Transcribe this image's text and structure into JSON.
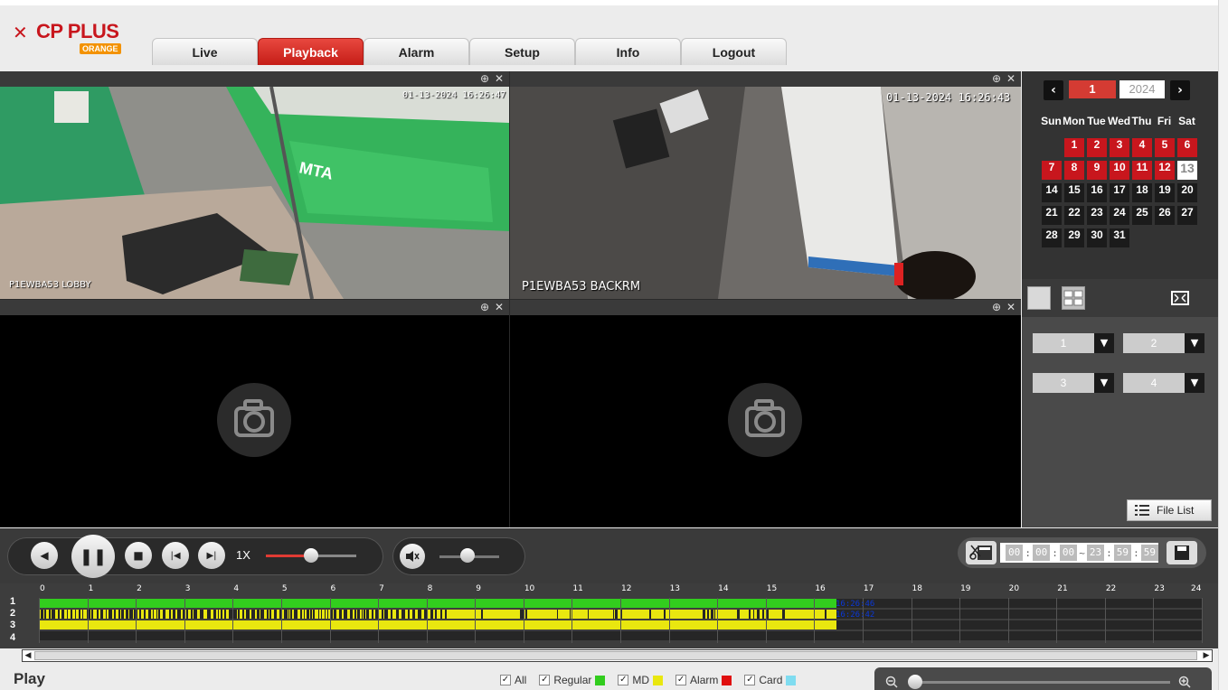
{
  "header": {
    "logo_text": "CP PLUS",
    "logo_sub": "ORANGE",
    "tabs": [
      "Live",
      "Playback",
      "Alarm",
      "Setup",
      "Info",
      "Logout"
    ],
    "active_tab": "Playback"
  },
  "panes": [
    {
      "label": "P1EWBA53 LOBBY",
      "timestamp": "01-13-2024 16:26:47"
    },
    {
      "label": "P1EWBA53 BACKRM",
      "timestamp": "01-13-2024 16:26:43"
    },
    {
      "label": "",
      "timestamp": ""
    },
    {
      "label": "",
      "timestamp": ""
    }
  ],
  "calendar": {
    "month": "1",
    "year": "2024",
    "prev": "‹",
    "next": "›",
    "dow": [
      "Sun",
      "Mon",
      "Tue",
      "Wed",
      "Thu",
      "Fri",
      "Sat"
    ],
    "days": [
      "1",
      "2",
      "3",
      "4",
      "5",
      "6",
      "7",
      "8",
      "9",
      "10",
      "11",
      "12",
      "13",
      "14",
      "15",
      "16",
      "17",
      "18",
      "19",
      "20",
      "21",
      "22",
      "23",
      "24",
      "25",
      "26",
      "27",
      "28",
      "29",
      "30",
      "31"
    ],
    "today": "13"
  },
  "channels": [
    "1",
    "2",
    "3",
    "4"
  ],
  "file_list_label": "File List",
  "controls": {
    "speed": "1X",
    "time_start": [
      "00",
      "00",
      "00"
    ],
    "time_end": [
      "23",
      "59",
      "59"
    ],
    "tilde": "~"
  },
  "timeline": {
    "rows": [
      "1",
      "2",
      "3",
      "4"
    ],
    "hours": [
      "0",
      "1",
      "2",
      "3",
      "4",
      "5",
      "6",
      "7",
      "8",
      "9",
      "10",
      "11",
      "12",
      "13",
      "14",
      "15",
      "16",
      "17",
      "18",
      "19",
      "20",
      "21",
      "22",
      "23",
      "24"
    ],
    "cursor_labels": [
      "16:26:46",
      "16:26:42"
    ]
  },
  "bottom": {
    "play_title": "Play",
    "legend": [
      {
        "label": "All",
        "color": ""
      },
      {
        "label": "Regular",
        "color": "#32cd1e"
      },
      {
        "label": "MD",
        "color": "#e9e70f"
      },
      {
        "label": "Alarm",
        "color": "#e01010"
      },
      {
        "label": "Card",
        "color": "#7fdcf0"
      }
    ]
  }
}
